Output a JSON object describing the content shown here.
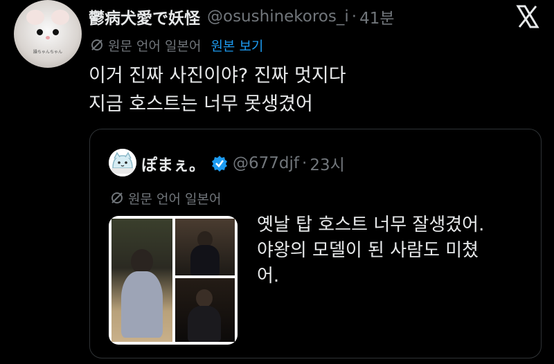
{
  "tweet": {
    "display_name": "鬱病犬愛で妖怪",
    "handle": "@osushinekoros_i",
    "separator": "·",
    "time": "41분",
    "avatar_caption": "躁ちゃんちゃん",
    "translate_label": "원문 언어 일본어",
    "translate_link": "원본 보기",
    "body_lines": [
      "이거 진짜 사진이야? 진짜 멋지다",
      "지금 호스트는 너무 못생겼어"
    ]
  },
  "quote": {
    "display_name": "ぽまぇ。",
    "handle": "@677djf",
    "separator": "·",
    "time": "23시",
    "verified": true,
    "translate_label": "원문 언어 일본어",
    "body_lines": [
      "옛날 탑 호스트 너무 잘생겼어.",
      "야왕의 모델이 된 사람도 미쳤",
      "어."
    ]
  },
  "icons": {
    "x_logo": "x-logo-icon",
    "translate": "translate-icon",
    "verified": "verified-badge-icon"
  },
  "colors": {
    "background": "#000000",
    "text": "#e7e9ea",
    "secondary": "#71767b",
    "link": "#1d9bf0",
    "border": "#2f3336"
  }
}
